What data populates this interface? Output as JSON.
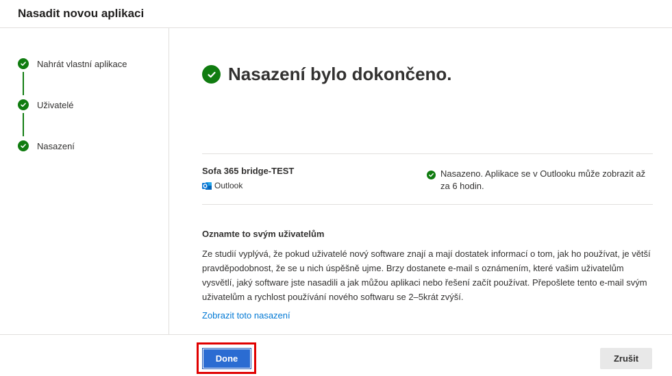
{
  "header": {
    "title": "Nasadit novou aplikaci"
  },
  "steps": [
    {
      "label": "Nahrát vlastní aplikace",
      "status": "completed"
    },
    {
      "label": "Uživatelé",
      "status": "completed"
    },
    {
      "label": "Nasazení",
      "status": "completed"
    }
  ],
  "main": {
    "title": "Nasazení bylo dokončeno.",
    "app": {
      "name": "Sofa 365 bridge-TEST",
      "host": "Outlook",
      "host_icon": "outlook-icon",
      "status_text": "Nasazeno. Aplikace se v Outlooku může zobrazit až za 6 hodin."
    },
    "notify": {
      "title": "Oznamte to svým uživatelům",
      "text": "Ze studií vyplývá, že pokud uživatelé nový software znají a mají dostatek informací o tom, jak ho používat, je větší pravděpodobnost, že se u nich úspěšně ujme. Brzy dostanete e-mail s oznámením, které vašim uživatelům vysvětlí, jaký software jste nasadili a jak můžou aplikaci nebo řešení začít používat. Přepošlete tento e-mail svým uživatelům a rychlost používání nového softwaru se 2–5krát zvýší.",
      "link": "Zobrazit toto nasazení"
    }
  },
  "footer": {
    "done_label": "Done",
    "cancel_label": "Zrušit"
  },
  "colors": {
    "success": "#107c10",
    "link": "#0078d4",
    "primary": "#2b6cd2",
    "highlight": "#e00000"
  }
}
